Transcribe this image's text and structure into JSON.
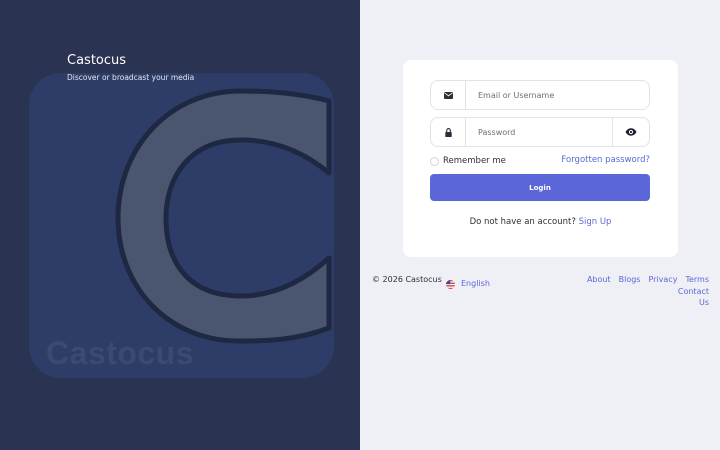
{
  "brand": {
    "title": "Castocus",
    "tagline": "Discover or broadcast your media",
    "logo_letter": "C",
    "logo_wordmark": "Castocus"
  },
  "login_form": {
    "email_placeholder": "Email or Username",
    "password_placeholder": "Password",
    "remember_label": "Remember me",
    "forgot_link": "Forgotten password?",
    "login_button": "Login",
    "signup_prompt": "Do not have an account?",
    "signup_link": "Sign Up"
  },
  "footer": {
    "copyright": "© 2026 Castocus",
    "language": "English",
    "links": {
      "about": "About",
      "blogs": "Blogs",
      "privacy": "Privacy",
      "terms": "Terms",
      "contact": "Contact Us"
    }
  },
  "icons": {
    "email": "envelope-icon",
    "password": "lock-icon",
    "toggle_password": "eye-icon",
    "language_flag": "us-flag-icon"
  },
  "colors": {
    "left_panel_bg": "#2a3452",
    "logo_tile": "#2e3d68",
    "accent": "#5b67d8",
    "page_bg": "#eef0f5"
  }
}
